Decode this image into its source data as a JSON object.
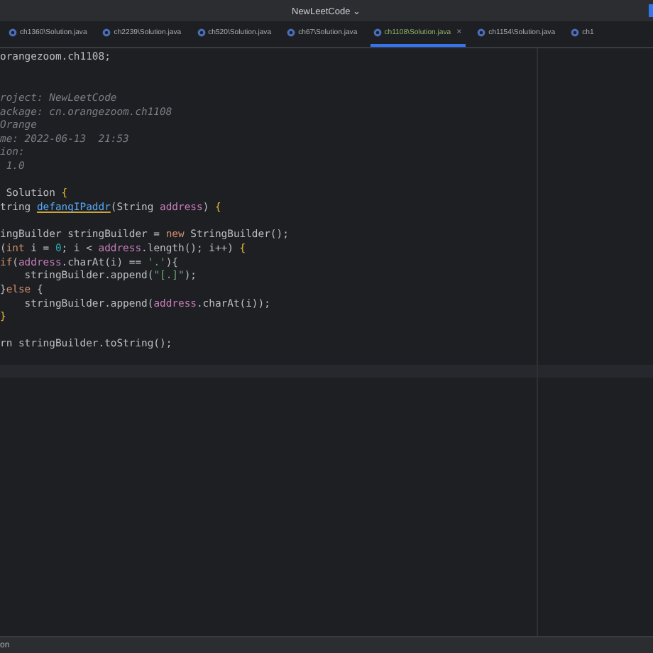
{
  "window": {
    "title": "NewLeetCode",
    "title_caret": "⌄"
  },
  "tabs": [
    {
      "label": "ch1360\\Solution.java",
      "selected": false
    },
    {
      "label": "ch2239\\Solution.java",
      "selected": false
    },
    {
      "label": "ch520\\Solution.java",
      "selected": false
    },
    {
      "label": "ch67\\Solution.java",
      "selected": false
    },
    {
      "label": "ch1108\\Solution.java",
      "selected": true
    },
    {
      "label": "ch1154\\Solution.java",
      "selected": false
    },
    {
      "label": "ch1",
      "selected": false
    }
  ],
  "tab_close": "×",
  "editor": {
    "lines": [
      {
        "kind": "code",
        "tokens": [
          {
            "text": "orangezoom.ch1108;",
            "kind": "plain"
          }
        ]
      },
      {
        "kind": "blank"
      },
      {
        "kind": "blank"
      },
      {
        "kind": "code",
        "tokens": [
          {
            "text": "roject: NewLeetCode",
            "kind": "comment"
          }
        ]
      },
      {
        "kind": "code",
        "tokens": [
          {
            "text": "ackage: cn.orangezoom.ch1108",
            "kind": "comment"
          }
        ]
      },
      {
        "kind": "code",
        "tokens": [
          {
            "text": "Orange",
            "kind": "comment"
          }
        ]
      },
      {
        "kind": "code",
        "tokens": [
          {
            "text": "me: 2022-06-13  21:53",
            "kind": "comment"
          }
        ]
      },
      {
        "kind": "code",
        "tokens": [
          {
            "text": "ion:",
            "kind": "comment"
          }
        ]
      },
      {
        "kind": "code",
        "tokens": [
          {
            "text": " 1.0",
            "kind": "comment"
          }
        ]
      },
      {
        "kind": "blank"
      },
      {
        "kind": "code",
        "tokens": [
          {
            "text": " Solution ",
            "kind": "plain"
          },
          {
            "text": "{",
            "kind": "brace"
          }
        ]
      },
      {
        "kind": "code",
        "tokens": [
          {
            "text": "tring ",
            "kind": "plain"
          },
          {
            "text": "defangIPaddr",
            "kind": "method"
          },
          {
            "text": "(String ",
            "kind": "plain"
          },
          {
            "text": "address",
            "kind": "param"
          },
          {
            "text": ") ",
            "kind": "plain"
          },
          {
            "text": "{",
            "kind": "brace"
          }
        ]
      },
      {
        "kind": "blank"
      },
      {
        "kind": "code",
        "tokens": [
          {
            "text": "ingBuilder stringBuilder = ",
            "kind": "plain"
          },
          {
            "text": "new",
            "kind": "keyword"
          },
          {
            "text": " StringBuilder();",
            "kind": "plain"
          }
        ]
      },
      {
        "kind": "code",
        "tokens": [
          {
            "text": "(",
            "kind": "plain"
          },
          {
            "text": "int",
            "kind": "keyword"
          },
          {
            "text": " i = ",
            "kind": "plain"
          },
          {
            "text": "0",
            "kind": "number"
          },
          {
            "text": "; i < ",
            "kind": "plain"
          },
          {
            "text": "address",
            "kind": "param"
          },
          {
            "text": ".length(); i++) ",
            "kind": "plain"
          },
          {
            "text": "{",
            "kind": "brace"
          }
        ]
      },
      {
        "kind": "code",
        "tokens": [
          {
            "text": "if",
            "kind": "keyword"
          },
          {
            "text": "(",
            "kind": "plain"
          },
          {
            "text": "address",
            "kind": "param"
          },
          {
            "text": ".charAt(i) == ",
            "kind": "plain"
          },
          {
            "text": "'.'",
            "kind": "string"
          },
          {
            "text": "){",
            "kind": "plain"
          }
        ]
      },
      {
        "kind": "code",
        "tokens": [
          {
            "text": "    stringBuilder.append(",
            "kind": "plain"
          },
          {
            "text": "\"[.]\"",
            "kind": "string"
          },
          {
            "text": ");",
            "kind": "plain"
          }
        ]
      },
      {
        "kind": "code",
        "tokens": [
          {
            "text": "}",
            "kind": "plain"
          },
          {
            "text": "else",
            "kind": "keyword"
          },
          {
            "text": " {",
            "kind": "plain"
          }
        ]
      },
      {
        "kind": "code",
        "tokens": [
          {
            "text": "    stringBuilder.append(",
            "kind": "plain"
          },
          {
            "text": "address",
            "kind": "param"
          },
          {
            "text": ".charAt(i));",
            "kind": "plain"
          }
        ]
      },
      {
        "kind": "code",
        "tokens": [
          {
            "text": "}",
            "kind": "brace"
          }
        ]
      },
      {
        "kind": "blank"
      },
      {
        "kind": "code",
        "tokens": [
          {
            "text": "rn stringBuilder.toString();",
            "kind": "plain"
          }
        ]
      },
      {
        "kind": "blank"
      },
      {
        "kind": "current_line"
      }
    ]
  },
  "status_bar": {
    "text": "on"
  }
}
